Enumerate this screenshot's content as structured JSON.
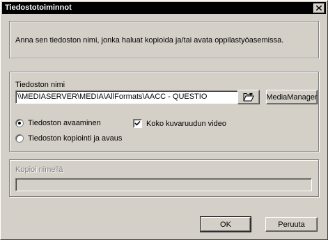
{
  "window": {
    "title": "Tiedostotoiminnot"
  },
  "instruction": "Anna sen tiedoston nimi, jonka haluat kopioida ja/tai avata oppilastyöasemissa.",
  "file": {
    "label": "Tiedoston nimi",
    "value": "\\\\MEDIASERVER\\MEDIA\\AllFormats\\AACC - QUESTIO",
    "browse_icon": "open-folder-icon",
    "media_manager_label": "MediaManager"
  },
  "options": {
    "open_label": "Tiedoston avaaminen",
    "copy_open_label": "Tiedoston kopiointi ja avaus",
    "selected": "open",
    "fullscreen_label": "Koko kuvaruudun video",
    "fullscreen_checked": true
  },
  "copy_name": {
    "label": "Kopioi nimellä",
    "value": ""
  },
  "buttons": {
    "ok": "OK",
    "cancel": "Peruuta"
  }
}
